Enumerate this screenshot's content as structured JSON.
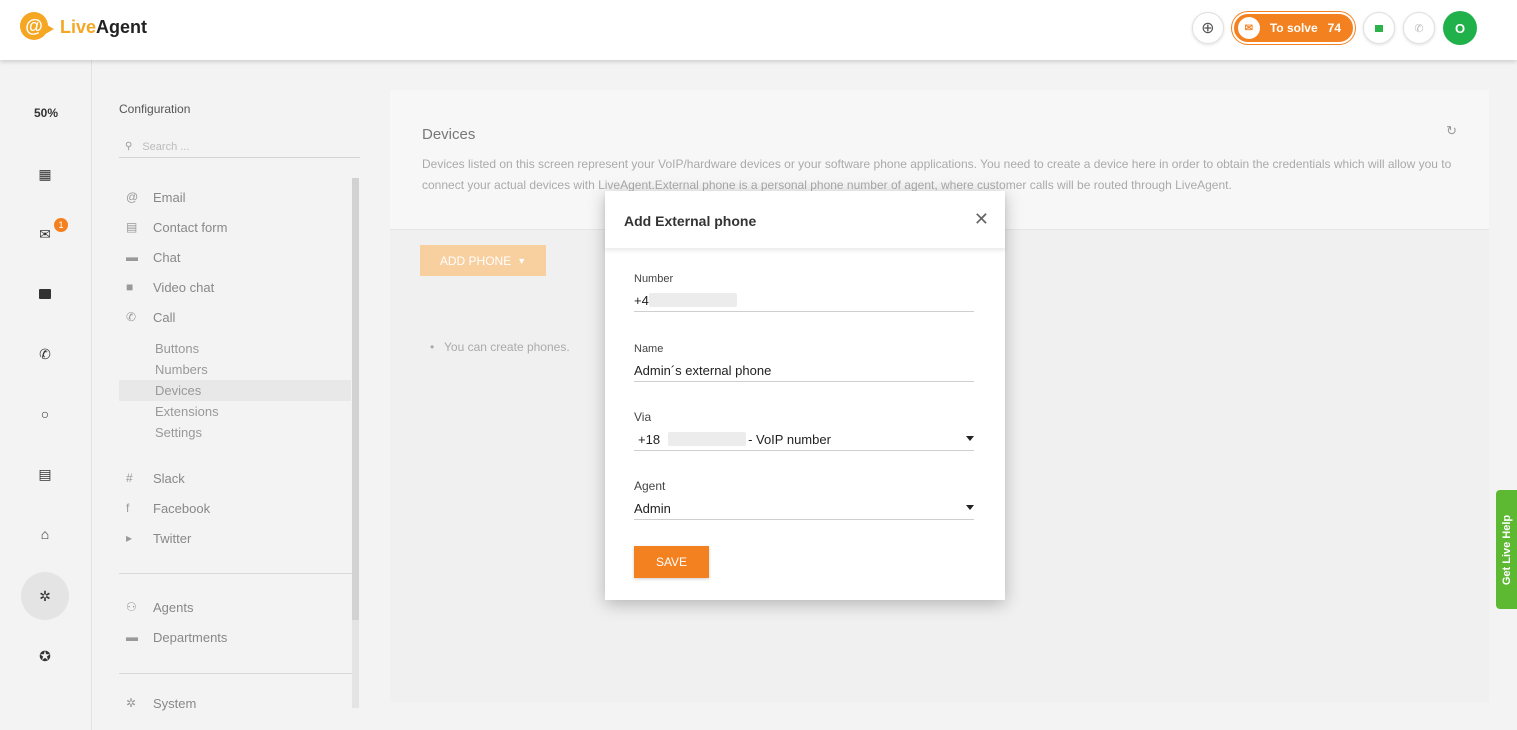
{
  "app": {
    "logo_live": "Live",
    "logo_agent": "Agent",
    "logo_symbol": "@"
  },
  "header": {
    "to_solve_label": "To solve",
    "to_solve_count": "74",
    "avatar_initial": "O"
  },
  "rail": {
    "zoom": "50%",
    "tickets_badge": "1"
  },
  "config": {
    "title": "Configuration",
    "search_placeholder": "Search ...",
    "channels": [
      {
        "label": "Email",
        "icon": "at-icon"
      },
      {
        "label": "Contact form",
        "icon": "form-icon"
      },
      {
        "label": "Chat",
        "icon": "chat-icon"
      },
      {
        "label": "Video chat",
        "icon": "video-icon"
      },
      {
        "label": "Call",
        "icon": "phone-icon"
      }
    ],
    "call_sub": [
      "Buttons",
      "Numbers",
      "Devices",
      "Extensions",
      "Settings"
    ],
    "social": [
      {
        "label": "Slack",
        "icon": "slack-icon"
      },
      {
        "label": "Facebook",
        "icon": "facebook-icon"
      },
      {
        "label": "Twitter",
        "icon": "twitter-icon"
      }
    ],
    "people": [
      {
        "label": "Agents",
        "icon": "agents-icon"
      },
      {
        "label": "Departments",
        "icon": "folder-icon"
      }
    ],
    "system": "System"
  },
  "devices": {
    "title": "Devices",
    "description": "Devices listed on this screen represent your VoIP/hardware devices or your software phone applications. You need to create a device here in order to obtain the credentials which will allow you to connect your actual devices with LiveAgent.External phone is a personal phone number of agent, where customer calls will be routed through LiveAgent.",
    "add_phone_label": "ADD PHONE",
    "hint": "You can create phones."
  },
  "modal": {
    "title": "Add External phone",
    "number_label": "Number",
    "number_value": "+4",
    "name_label": "Name",
    "name_value": "Admin´s external phone",
    "via_label": "Via",
    "via_prefix": "+18",
    "via_suffix": "- VoIP number",
    "agent_label": "Agent",
    "agent_value": "Admin",
    "save_label": "SAVE"
  },
  "live_help": "Get Live Help",
  "colors": {
    "brand_orange": "#f48120",
    "logo_orange": "#f5a623",
    "green": "#21b14a",
    "help_green": "#5db832"
  }
}
